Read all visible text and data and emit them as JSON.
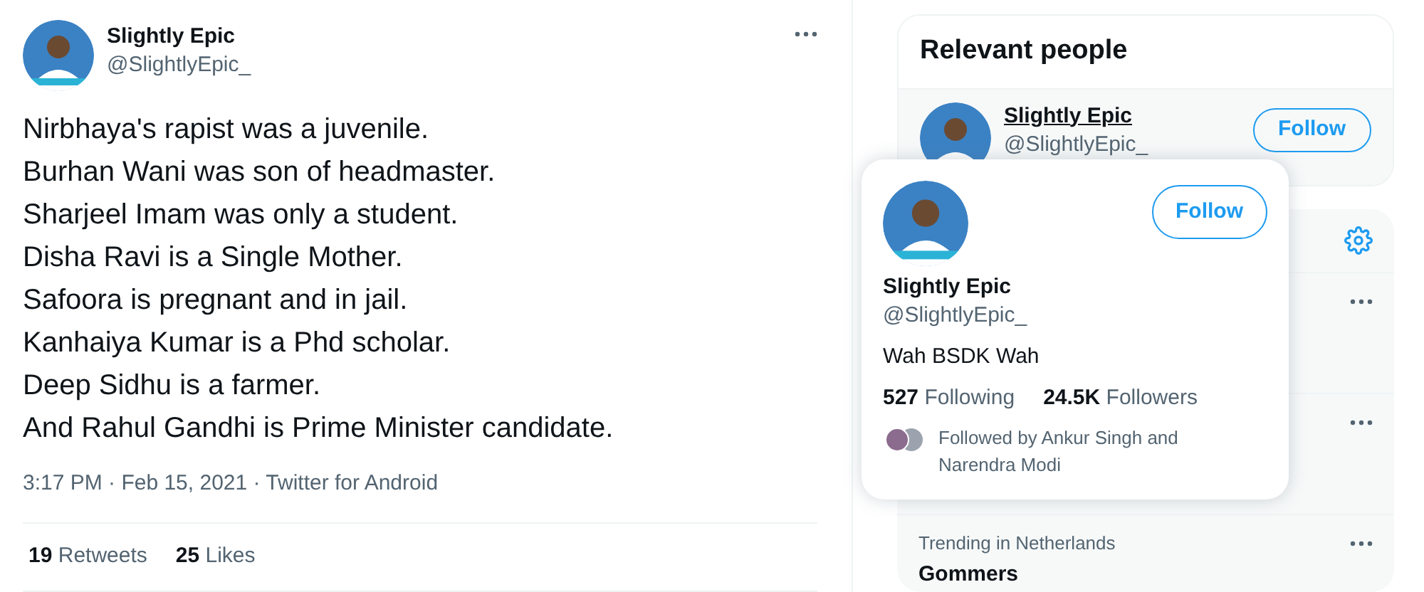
{
  "tweet": {
    "author": {
      "name": "Slightly Epic",
      "handle": "@SlightlyEpic_"
    },
    "lines": [
      "Nirbhaya's rapist was a juvenile.",
      "Burhan Wani was son of headmaster.",
      "Sharjeel Imam was only a student.",
      "Disha Ravi is a Single Mother.",
      "Safoora is pregnant and in jail.",
      "Kanhaiya Kumar is a Phd scholar.",
      "Deep Sidhu is a farmer.",
      "And Rahul Gandhi is Prime Minister candidate."
    ],
    "timestamp": "3:17 PM · Feb 15, 2021 · Twitter for Android",
    "stats": [
      {
        "count": "19",
        "label": "Retweets"
      },
      {
        "count": "25",
        "label": "Likes"
      }
    ]
  },
  "relevant_people": {
    "title": "Relevant people",
    "person": {
      "name": "Slightly Epic",
      "handle": "@SlightlyEpic_",
      "follow_label": "Follow"
    }
  },
  "trends": {
    "items": [
      {
        "context": "Trending in Netherlands",
        "name": "Gommers"
      }
    ]
  },
  "hover_card": {
    "name": "Slightly Epic",
    "handle": "@SlightlyEpic_",
    "bio": "Wah BSDK Wah",
    "follow_label": "Follow",
    "stats": [
      {
        "count": "527",
        "label": "Following"
      },
      {
        "count": "24.5K",
        "label": "Followers"
      }
    ],
    "followed_by": "Followed by Ankur Singh and Narendra Modi"
  }
}
